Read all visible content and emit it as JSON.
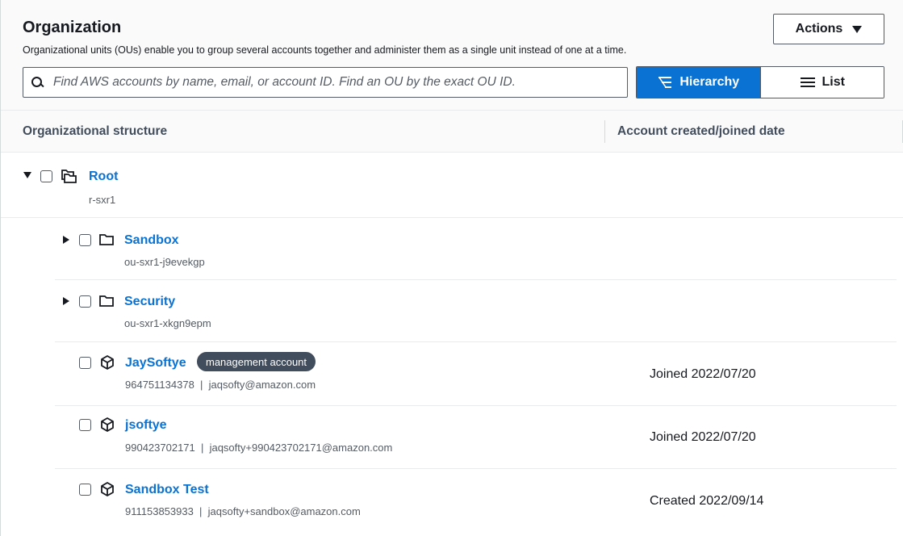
{
  "header": {
    "title": "Organization",
    "subtitle": "Organizational units (OUs) enable you to group several accounts together and administer them as a single unit instead of one at a time.",
    "actions_label": "Actions"
  },
  "search": {
    "placeholder": "Find AWS accounts by name, email, or account ID. Find an OU by the exact OU ID.",
    "value": ""
  },
  "view_toggle": {
    "hierarchy_label": "Hierarchy",
    "list_label": "List",
    "selected": "Hierarchy"
  },
  "table": {
    "columns": [
      "Organizational structure",
      "Account created/joined date"
    ],
    "root": {
      "name": "Root",
      "id": "r-sxr1",
      "expanded": true
    },
    "ous": [
      {
        "name": "Sandbox",
        "id": "ou-sxr1-j9evekgp",
        "expanded": false
      },
      {
        "name": "Security",
        "id": "ou-sxr1-xkgn9epm",
        "expanded": false
      }
    ],
    "accounts": [
      {
        "name": "JaySoftye",
        "badge": "management account",
        "meta": "964751134378  |  jaqsofty@amazon.com",
        "date": "Joined 2022/07/20"
      },
      {
        "name": "jsoftye",
        "badge": "",
        "meta": "990423702171  |  jaqsofty+990423702171@amazon.com",
        "date": "Joined 2022/07/20"
      },
      {
        "name": "Sandbox Test",
        "badge": "",
        "meta": "911153853933  |  jaqsofty+sandbox@amazon.com",
        "date": "Created 2022/09/14"
      }
    ]
  },
  "icons": {
    "search": "search-icon",
    "actions_caret": "caret-down-icon",
    "hierarchy": "hierarchy-icon",
    "list": "list-icon",
    "root": "folders-icon",
    "ou": "folder-icon",
    "account": "cube-icon"
  },
  "colors": {
    "link": "#0972d3",
    "active_toggle": "#0972d3",
    "badge_bg": "#414d5c"
  }
}
